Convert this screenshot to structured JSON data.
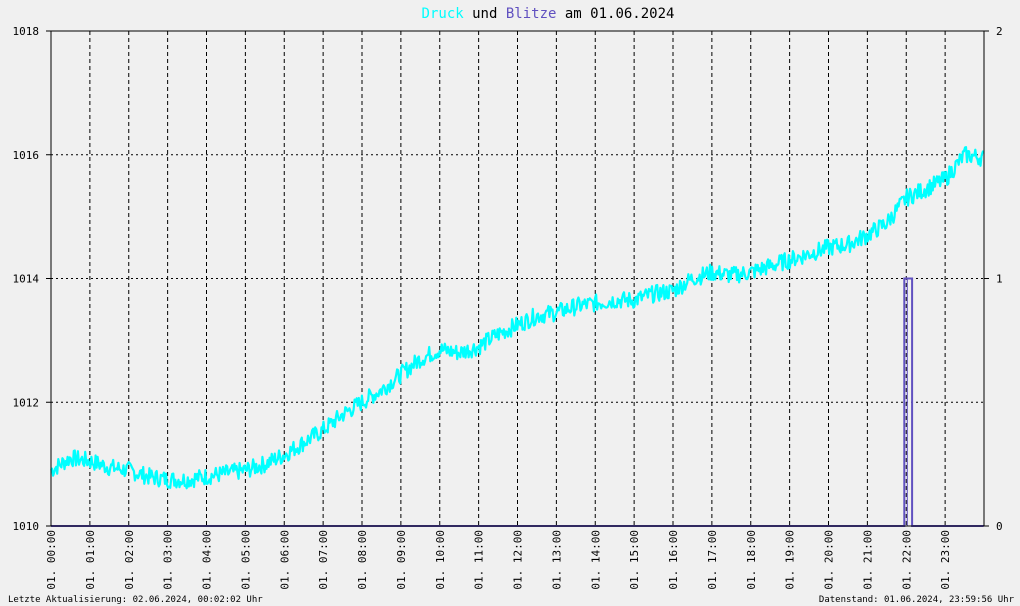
{
  "title": {
    "series1": "Druck",
    "connector": " und ",
    "series2": "Blitze",
    "suffix": " am 01.06.2024"
  },
  "colors": {
    "background": "#f0f0f0",
    "pressure": "#00ffff",
    "lightning": "#6050c0",
    "axis": "#000000",
    "grid": "#000000"
  },
  "footer": {
    "left": "Letzte Aktualisierung: 02.06.2024, 00:02:02 Uhr",
    "right": "Datenstand: 01.06.2024, 23:59:56 Uhr"
  },
  "chart_data": {
    "type": "line",
    "title": "Druck und Blitze am 01.06.2024",
    "y_left": {
      "min": 1010,
      "max": 1018,
      "ticks": [
        "1010",
        "1012",
        "1014",
        "1016",
        "1018"
      ]
    },
    "y_right": {
      "min": 0,
      "max": 2,
      "ticks": [
        "0",
        "1",
        "2"
      ]
    },
    "x_range_hours": [
      0,
      24
    ],
    "x_ticks": [
      "01. 00:00",
      "01. 01:00",
      "01. 02:00",
      "01. 03:00",
      "01. 04:00",
      "01. 05:00",
      "01. 06:00",
      "01. 07:00",
      "01. 08:00",
      "01. 09:00",
      "01. 10:00",
      "01. 11:00",
      "01. 12:00",
      "01. 13:00",
      "01. 14:00",
      "01. 15:00",
      "01. 16:00",
      "01. 17:00",
      "01. 18:00",
      "01. 19:00",
      "01. 20:00",
      "01. 21:00",
      "01. 22:00",
      "01. 23:00"
    ],
    "grid": true,
    "series": [
      {
        "name": "Druck",
        "axis": "left",
        "x": [
          0.0,
          0.5,
          1.0,
          1.5,
          2.0,
          2.5,
          3.0,
          3.5,
          4.0,
          4.5,
          5.0,
          5.5,
          6.0,
          6.5,
          7.0,
          7.5,
          8.0,
          8.5,
          9.0,
          9.5,
          10.0,
          10.5,
          11.0,
          11.5,
          12.0,
          12.5,
          13.0,
          13.5,
          14.0,
          14.5,
          15.0,
          15.5,
          16.0,
          16.5,
          17.0,
          17.5,
          18.0,
          18.5,
          19.0,
          19.5,
          20.0,
          20.5,
          21.0,
          21.5,
          22.0,
          22.5,
          23.0,
          23.5,
          23.99
        ],
        "values": [
          1010.9,
          1011.1,
          1011.05,
          1010.95,
          1010.9,
          1010.8,
          1010.75,
          1010.75,
          1010.8,
          1010.85,
          1010.9,
          1011.0,
          1011.15,
          1011.35,
          1011.55,
          1011.8,
          1012.0,
          1012.2,
          1012.45,
          1012.7,
          1012.85,
          1012.8,
          1012.9,
          1013.1,
          1013.25,
          1013.4,
          1013.45,
          1013.55,
          1013.6,
          1013.65,
          1013.65,
          1013.75,
          1013.8,
          1014.0,
          1014.1,
          1014.05,
          1014.1,
          1014.2,
          1014.3,
          1014.4,
          1014.5,
          1014.55,
          1014.7,
          1014.9,
          1015.3,
          1015.45,
          1015.6,
          1016.0,
          1015.95
        ]
      },
      {
        "name": "Blitze",
        "axis": "right",
        "x": [
          0.0,
          21.95,
          21.95,
          22.15,
          22.15,
          23.99
        ],
        "values": [
          0,
          0,
          1,
          1,
          0,
          0
        ]
      }
    ]
  }
}
